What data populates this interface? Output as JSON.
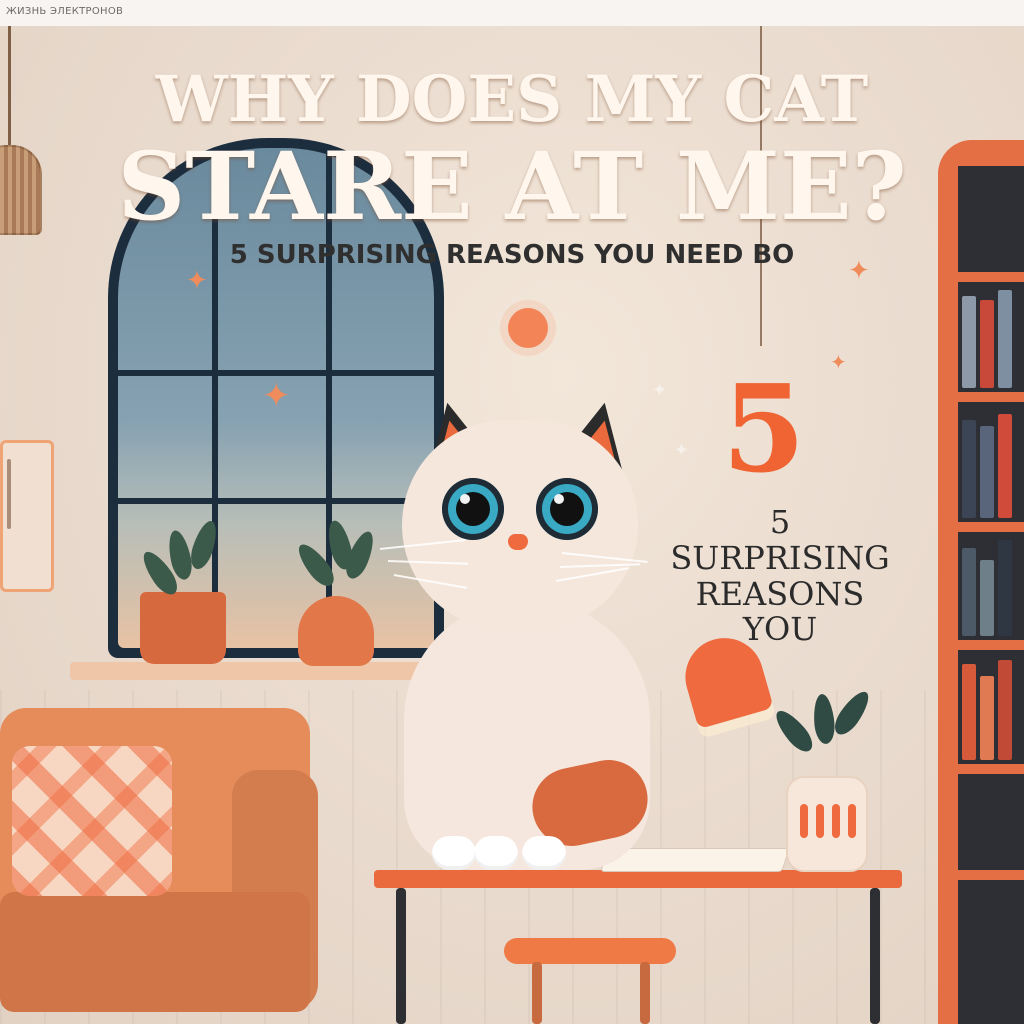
{
  "header": {
    "text": "ЖИЗНЬ ЭЛЕКТРОНОВ"
  },
  "poster": {
    "headline_line_1": "WHY DOES MY CAT",
    "headline_line_2": "STARE AT ME?",
    "subheadline": "5 SURPRISING REASONS YOU NEED BO",
    "side_number": "5",
    "side_text_line_1": "5 SURPRISING",
    "side_text_line_2": "REASONS YOU"
  },
  "palette": {
    "accent_orange": "#ef6a3e",
    "warm_wall": "#e8ddd3",
    "deep_navy": "#1c2d3e",
    "eye_blue": "#39a9c4"
  },
  "icons": {
    "cat": "cat-illustration",
    "lamp": "pendant-lamp-icon",
    "sparkle": "sparkle-icon",
    "bookshelf": "bookshelf-icon",
    "plant": "plant-icon"
  }
}
